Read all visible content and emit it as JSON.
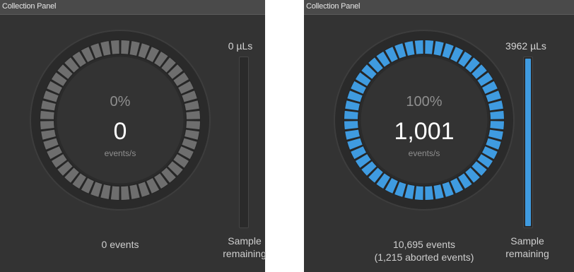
{
  "panels": [
    {
      "title": "Collection Panel",
      "gauge": {
        "percent_label": "0%",
        "rate": "0",
        "unit": "events/s",
        "fill_fraction": 0,
        "segment_count": 48,
        "active_color": "#3f9be0",
        "inactive_color": "#6e6e6e"
      },
      "volume": "0 µLs",
      "sample_fill_fraction": 0,
      "sample_label": [
        "Sample",
        "remaining"
      ],
      "events": "0 events",
      "aborted": ""
    },
    {
      "title": "Collection Panel",
      "gauge": {
        "percent_label": "100%",
        "rate": "1,001",
        "unit": "events/s",
        "fill_fraction": 1,
        "segment_count": 48,
        "active_color": "#3f9be0",
        "inactive_color": "#6e6e6e"
      },
      "volume": "3962 µLs",
      "sample_fill_fraction": 1,
      "sample_label": [
        "Sample",
        "remaining"
      ],
      "events": "10,695 events",
      "aborted": "(1,215 aborted events)"
    }
  ]
}
